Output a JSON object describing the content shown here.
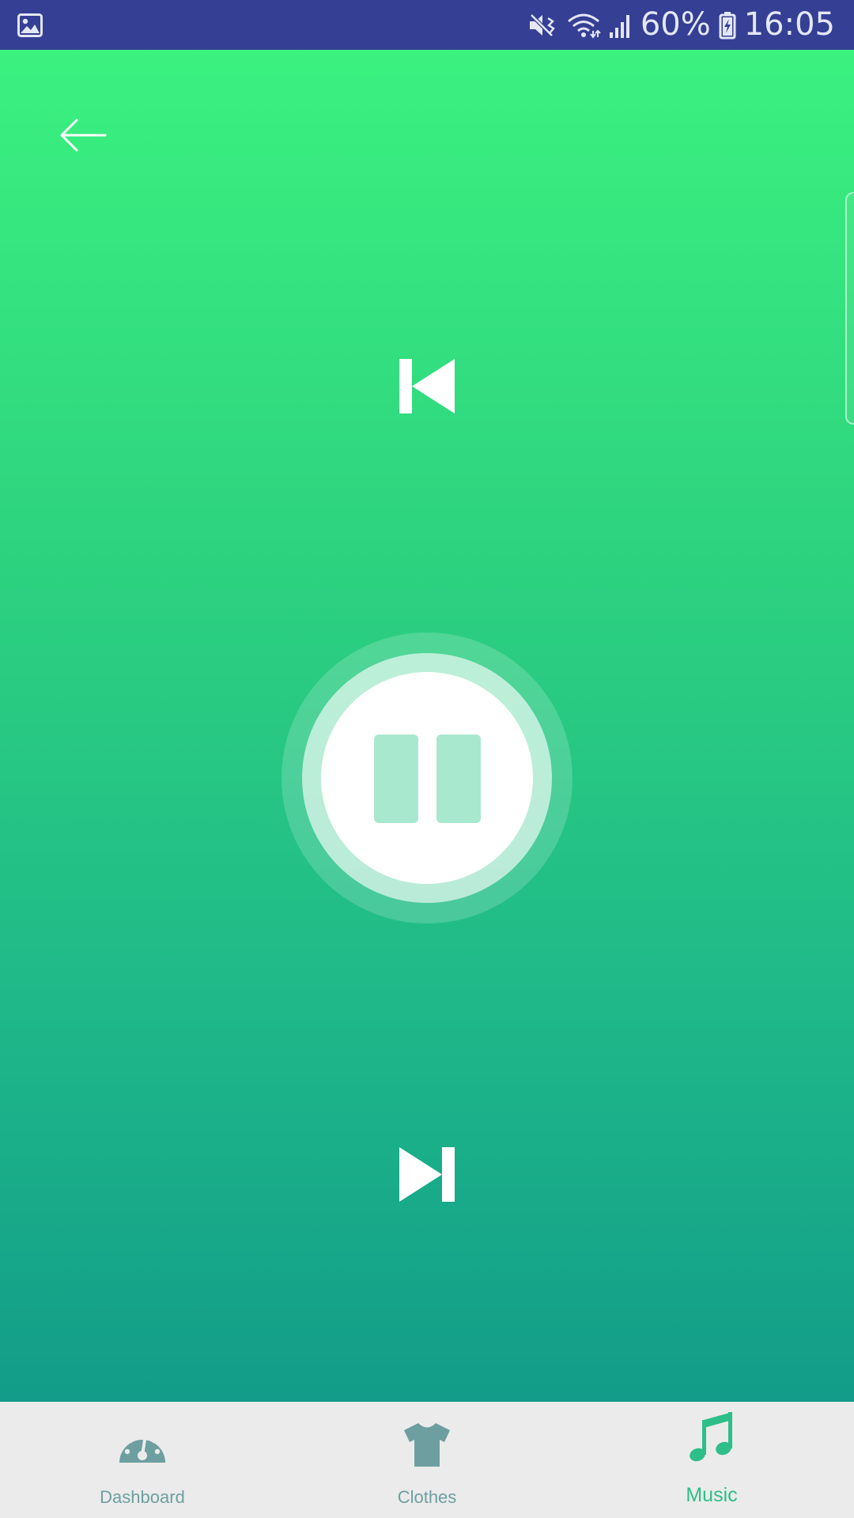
{
  "status_bar": {
    "battery_percent": "60%",
    "time": "16:05",
    "icons": [
      "image-icon",
      "mute-icon",
      "wifi-icon",
      "signal-icon",
      "battery-charging-icon"
    ]
  },
  "player": {
    "state": "playing",
    "background_gradient": [
      "#3BF17F",
      "#129C89"
    ],
    "controls": [
      "previous-track",
      "pause",
      "next-track"
    ]
  },
  "bottom_nav": {
    "items": [
      {
        "label": "Dashboard",
        "icon": "speedometer-icon",
        "active": false
      },
      {
        "label": "Clothes",
        "icon": "tshirt-icon",
        "active": false
      },
      {
        "label": "Music",
        "icon": "music-note-icon",
        "active": true
      }
    ],
    "colors": {
      "inactive": "#6E9FA0",
      "active": "#2DBE8A",
      "background": "#EBEBEB"
    }
  }
}
